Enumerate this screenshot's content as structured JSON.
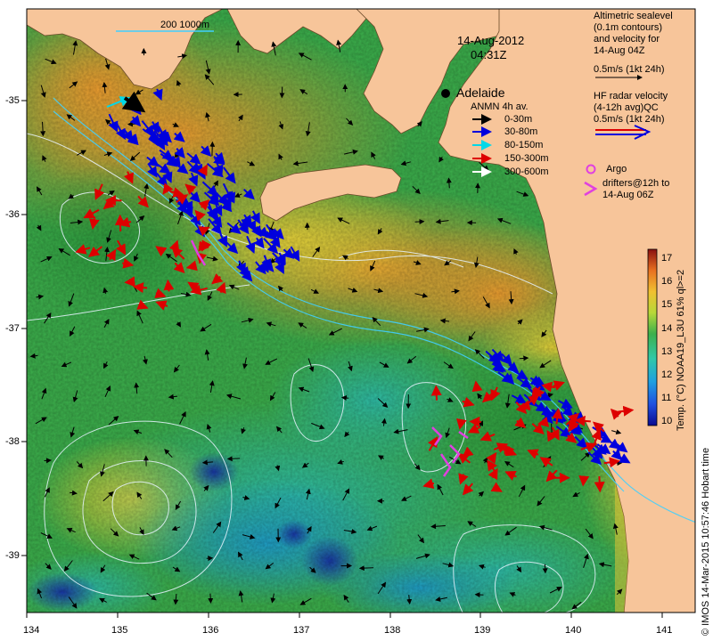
{
  "map": {
    "date": "14-Aug-2012",
    "time": "04:31Z",
    "city": "Adelaide",
    "scale_label": "200  1000m",
    "x_ticks": [
      "134",
      "135",
      "136",
      "137",
      "138",
      "139",
      "140",
      "141"
    ],
    "y_ticks": [
      "-35",
      "-36",
      "-37",
      "-38",
      "-39"
    ],
    "lon_range": [
      134,
      141.3
    ],
    "lat_range": [
      -39.5,
      -34.2
    ],
    "colors": {
      "land": "#f7c59a",
      "ocean_warm": "#f0a030",
      "ocean_mid": "#3cb04c",
      "ocean_cool": "#2fbfa8",
      "ocean_cold": "#1838a8",
      "contour": "#e8f4ff",
      "bathy": "#40d0ff"
    }
  },
  "legend": {
    "altimetry": [
      "Altimetric sealevel",
      "(0.1m contours)",
      "and velocity for",
      "14-Aug 04Z",
      "0.5m/s (1kt 24h)"
    ],
    "hf_radar": [
      "HF radar velocity",
      "(4-12h avg)QC",
      "0.5m/s (1kt 24h)"
    ],
    "anmn_title": "ANMN 4h av.",
    "anmn_items": [
      {
        "label": "0-30m",
        "color": "#000000"
      },
      {
        "label": "30-80m",
        "color": "#0000dd"
      },
      {
        "label": "80-150m",
        "color": "#00d8e8"
      },
      {
        "label": "150-300m",
        "color": "#dd0000"
      },
      {
        "label": "300-600m",
        "color": "#ffffff"
      }
    ],
    "argo": [
      "Argo",
      "drifters@12h to",
      "14-Aug 06Z"
    ]
  },
  "colorbar": {
    "ticks": [
      "17",
      "16",
      "15",
      "14",
      "13",
      "12",
      "11",
      "10"
    ],
    "label": "Temp. (°C) NOAA19_L3U 61% ql>=2",
    "range": [
      10,
      17.5
    ]
  },
  "credit": "© IMOS 14-Mar-2015 10:57:46 Hobart time"
}
